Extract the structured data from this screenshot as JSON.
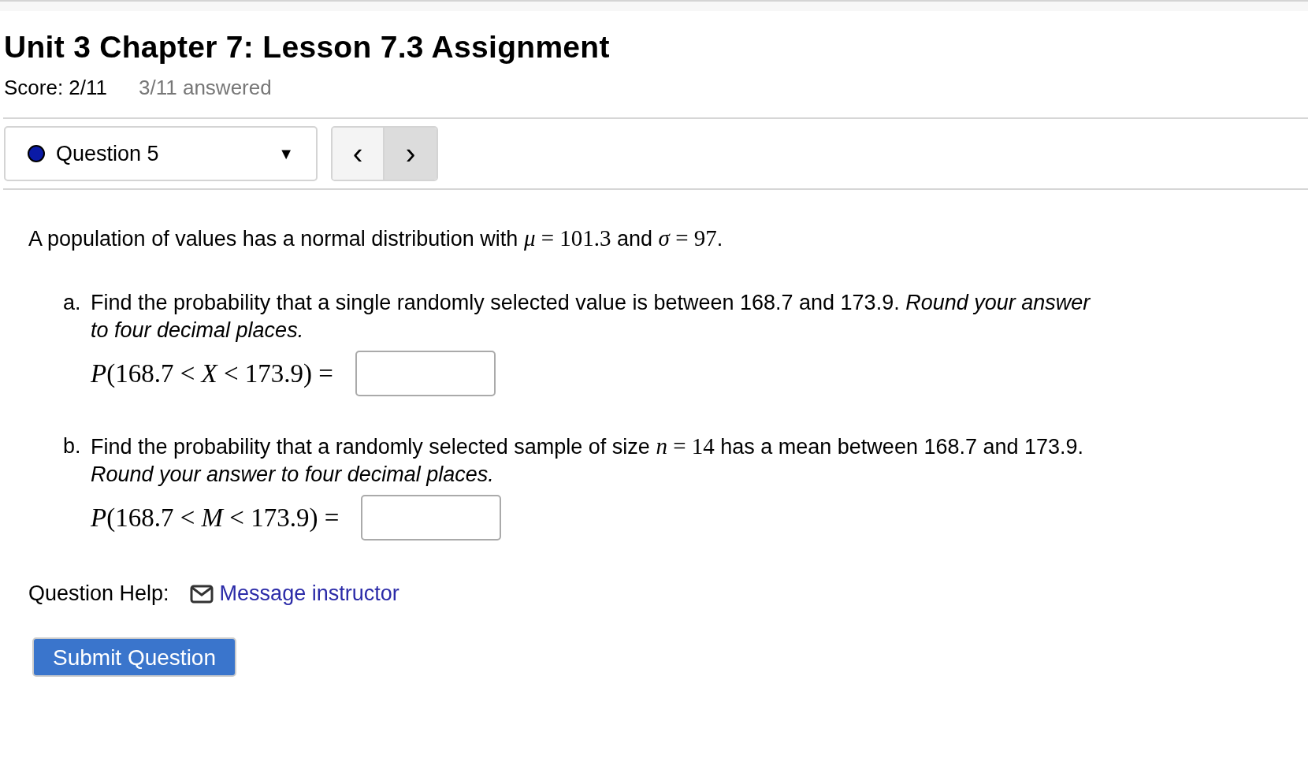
{
  "title": "Unit 3 Chapter 7: Lesson 7.3 Assignment",
  "score": "Score: 2/11",
  "answered": "3/11 answered",
  "question_select": {
    "label": "Question 5",
    "caret": "▼"
  },
  "nav_buttons": [
    {
      "label": "‹",
      "kind": "prev"
    },
    {
      "label": "›",
      "kind": "next"
    }
  ],
  "statement": [
    {
      "kind": "text",
      "text": "A population of values has a normal distribution with "
    },
    {
      "kind": "math",
      "text": "*μ* = 101.3"
    },
    {
      "kind": "text",
      "text": " and "
    },
    {
      "kind": "math",
      "text": "*σ* = 97"
    },
    {
      "kind": "text",
      "text": "."
    }
  ],
  "parts": [
    {
      "marker": "a.",
      "body": [
        {
          "kind": "text",
          "text": "Find the probability that a single randomly selected value is between 168.7 and 173.9. *Round your answer to four decimal places.*"
        }
      ],
      "equation": "*P*(168.7 < *X* < 173.9) ="
    },
    {
      "marker": "b.",
      "body": [
        {
          "kind": "text",
          "text": "Find the probability that a randomly selected sample of size "
        },
        {
          "kind": "math",
          "text": "*n* = 14"
        },
        {
          "kind": "text",
          "text": " has a mean between 168.7 and 173.9. *Round your answer to four decimal places.*"
        }
      ],
      "equation": "*P*(168.7 < *M* < 173.9) ="
    }
  ],
  "help": {
    "label": "Question Help:",
    "link": "Message instructor"
  },
  "submit": "Submit Question"
}
